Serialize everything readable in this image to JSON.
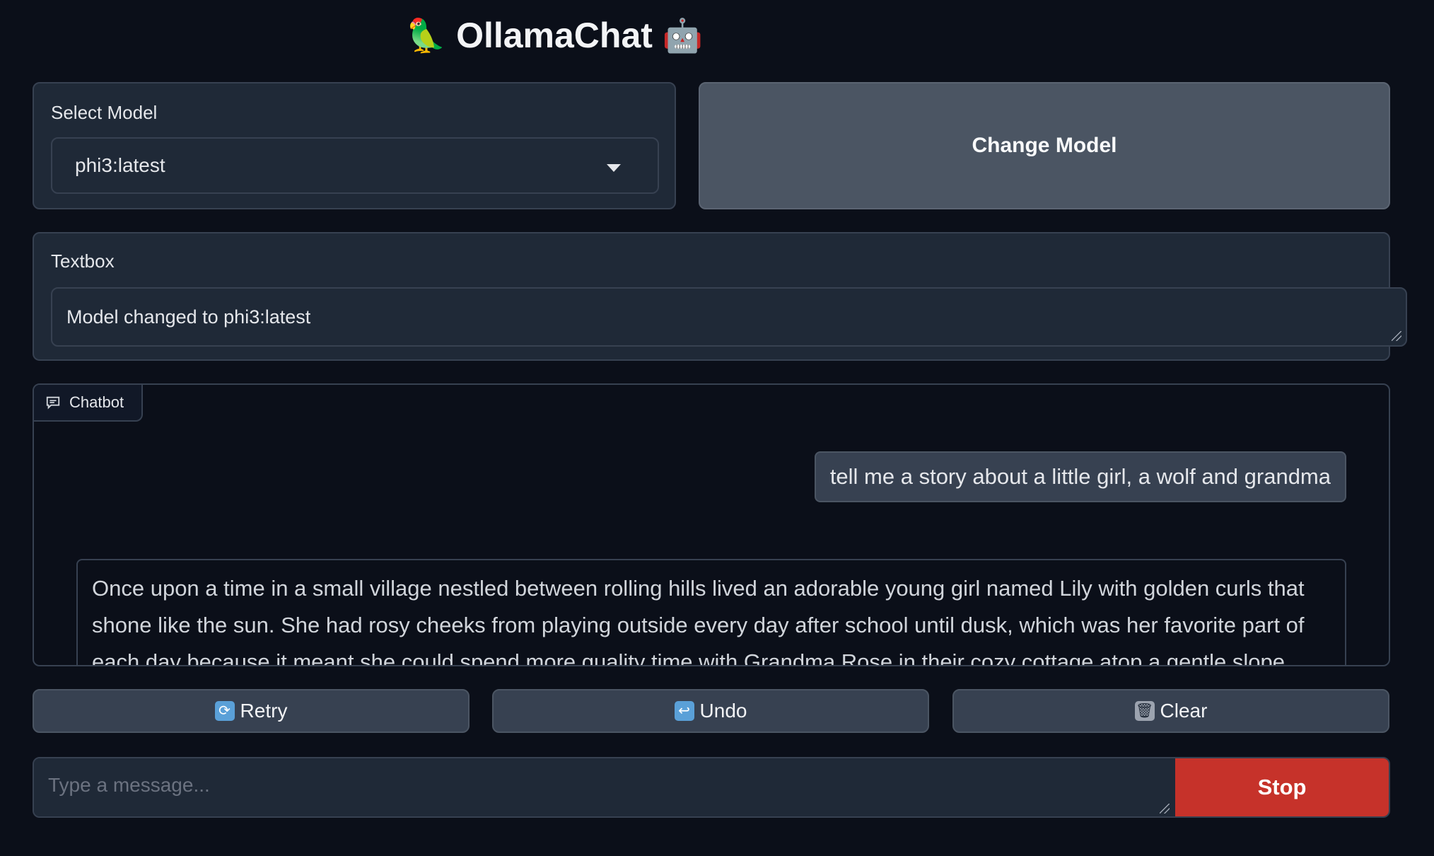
{
  "app": {
    "title": "OllamaChat",
    "title_left_emoji": "🦜",
    "title_right_emoji": "🤖"
  },
  "model_select": {
    "label": "Select Model",
    "value": "phi3:latest",
    "icon": "chevron-down-icon"
  },
  "change_model_button": {
    "label": "Change Model"
  },
  "textbox": {
    "label": "Textbox",
    "value": "Model changed to phi3:latest"
  },
  "chatbot": {
    "label": "Chatbot",
    "icon": "chat-icon",
    "messages": [
      {
        "role": "user",
        "text": "tell me a story about a little girl, a wolf and grandma"
      },
      {
        "role": "assistant",
        "text": "Once upon a time in a small village nestled between rolling hills lived an adorable young girl named Lily with golden curls that shone like the sun. She had rosy cheeks from playing outside every day after school until dusk, which was her favorite part of each day because it meant she could spend more quality time with Grandma Rose in their cozy cottage atop a gentle slope overlooking"
      }
    ]
  },
  "actions": {
    "retry": {
      "label": "Retry",
      "icon": "🔄"
    },
    "undo": {
      "label": "Undo",
      "icon": "↩️"
    },
    "clear": {
      "label": "Clear",
      "icon": "🗑️"
    }
  },
  "composer": {
    "placeholder": "Type a message...",
    "stop_label": "Stop"
  },
  "colors": {
    "background": "#0b0f19",
    "panel": "#1f2937",
    "border": "#374151",
    "stop": "#c6322a"
  }
}
